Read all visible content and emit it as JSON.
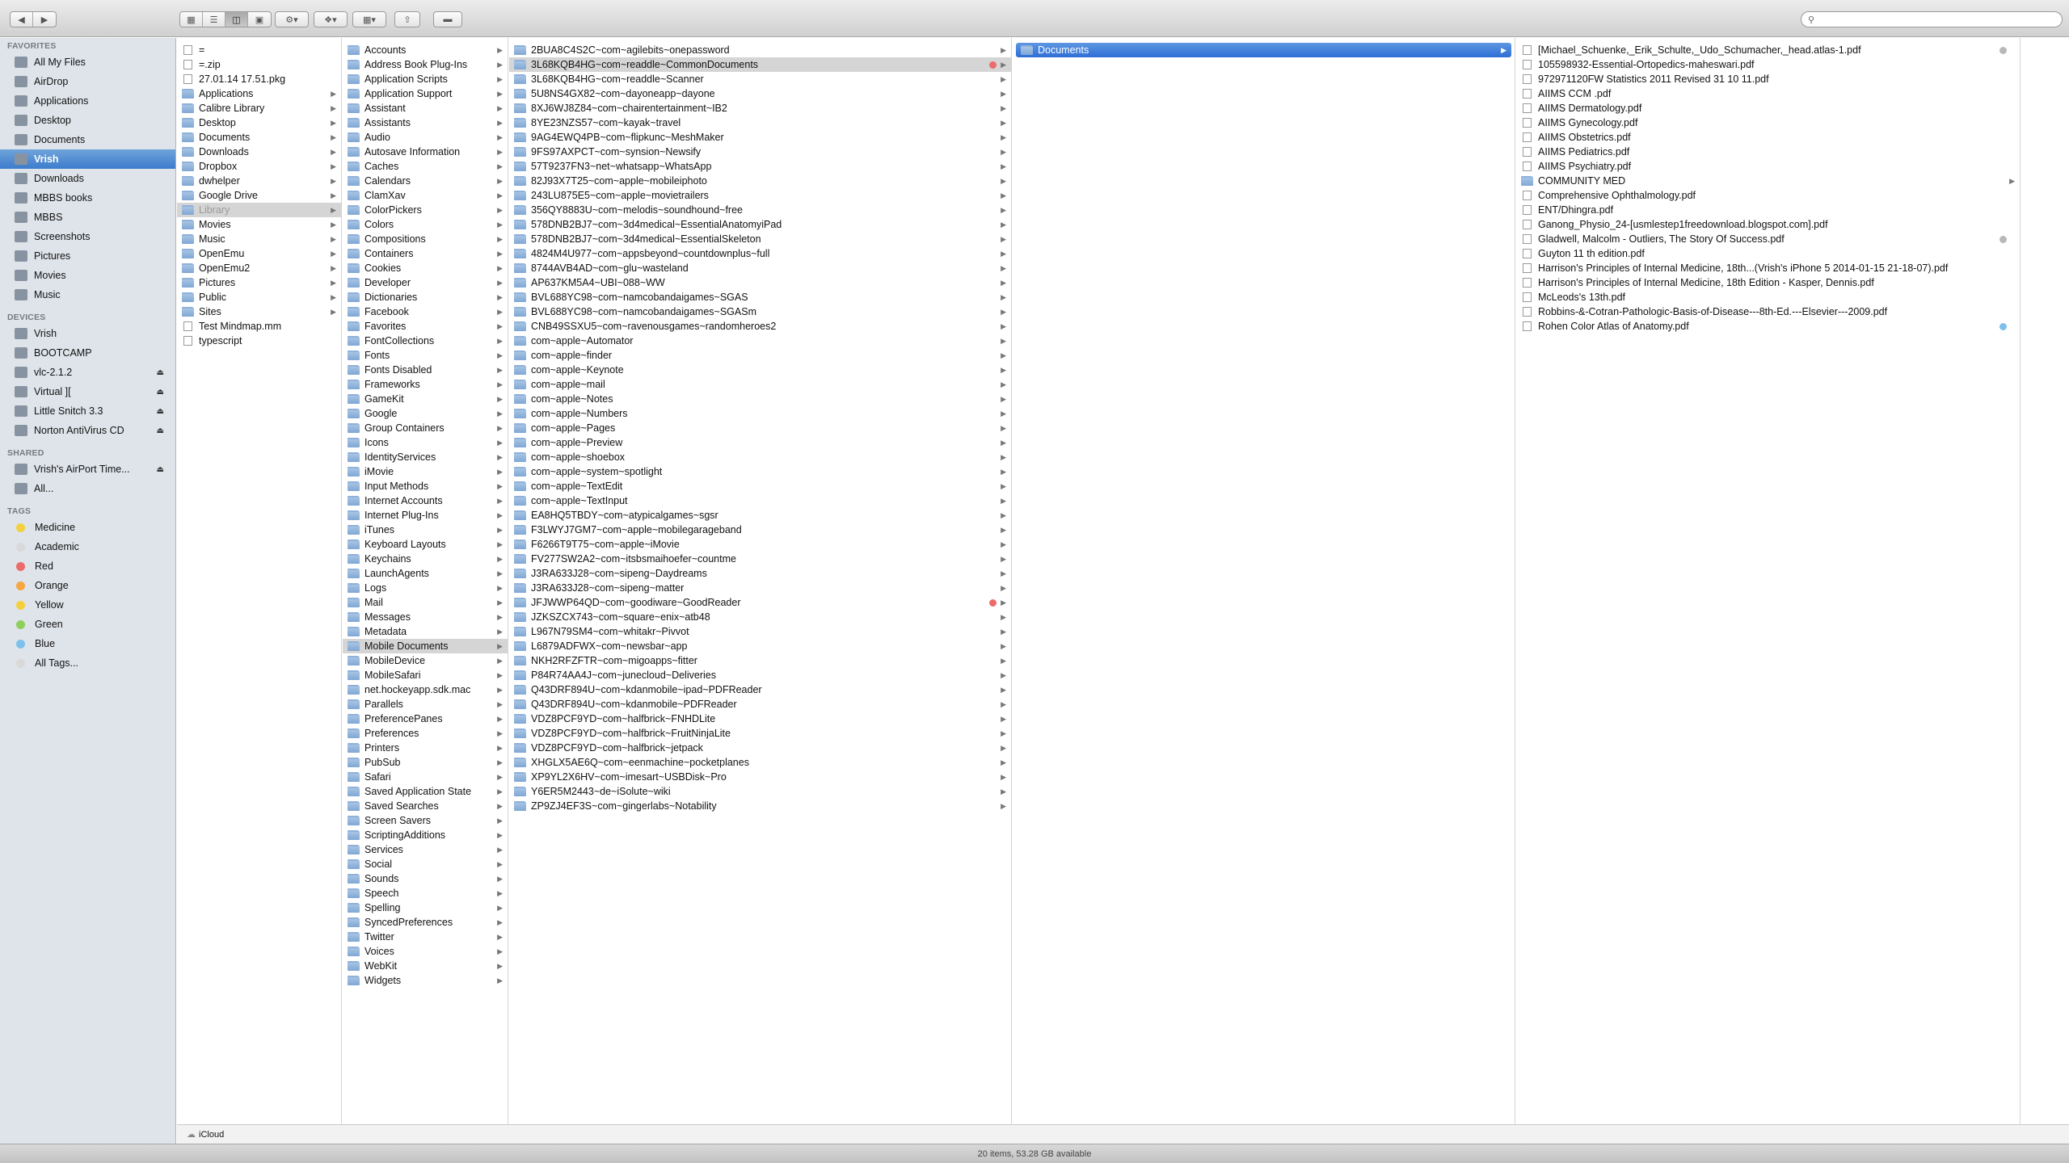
{
  "toolbar": {
    "back_icon": "chevron-left-icon",
    "forward_icon": "chevron-right-icon",
    "view_modes": [
      "icon-view-icon",
      "list-view-icon",
      "column-view-icon",
      "coverflow-view-icon"
    ],
    "action_icon": "gear-icon",
    "dropbox_icon": "dropbox-icon",
    "arrange_icon": "arrange-icon",
    "share_icon": "share-icon",
    "tags_icon": "tag-icon",
    "search_placeholder": ""
  },
  "sidebar": {
    "favorites_header": "FAVORITES",
    "favorites": [
      {
        "label": "All My Files",
        "icon": "all-files-icon"
      },
      {
        "label": "AirDrop",
        "icon": "airdrop-icon"
      },
      {
        "label": "Applications",
        "icon": "applications-icon"
      },
      {
        "label": "Desktop",
        "icon": "desktop-icon"
      },
      {
        "label": "Documents",
        "icon": "documents-icon"
      },
      {
        "label": "Vrish",
        "icon": "home-icon",
        "selected": true
      },
      {
        "label": "Downloads",
        "icon": "downloads-icon"
      },
      {
        "label": "MBBS books",
        "icon": "folder-icon"
      },
      {
        "label": "MBBS",
        "icon": "folder-icon"
      },
      {
        "label": "Screenshots",
        "icon": "folder-icon"
      },
      {
        "label": "Pictures",
        "icon": "pictures-icon"
      },
      {
        "label": "Movies",
        "icon": "movies-icon"
      },
      {
        "label": "Music",
        "icon": "music-icon"
      }
    ],
    "devices_header": "DEVICES",
    "devices": [
      {
        "label": "Vrish",
        "icon": "computer-icon",
        "eject": false
      },
      {
        "label": "BOOTCAMP",
        "icon": "drive-icon",
        "eject": false
      },
      {
        "label": "vlc-2.1.2",
        "icon": "disk-image-icon",
        "eject": true
      },
      {
        "label": "Virtual ][",
        "icon": "disk-image-icon",
        "eject": true
      },
      {
        "label": "Little Snitch 3.3",
        "icon": "disk-image-icon",
        "eject": true
      },
      {
        "label": "Norton AntiVirus CD",
        "icon": "disk-image-icon",
        "eject": true
      }
    ],
    "shared_header": "SHARED",
    "shared": [
      {
        "label": "Vrish's AirPort Time...",
        "icon": "airport-icon",
        "eject": true
      },
      {
        "label": "All...",
        "icon": "network-icon",
        "eject": false
      }
    ],
    "tags_header": "TAGS",
    "tags": [
      {
        "label": "Medicine",
        "color": "#f4d03f"
      },
      {
        "label": "Academic",
        "color": "#d9d9d9"
      },
      {
        "label": "Red",
        "color": "#ec6b6b"
      },
      {
        "label": "Orange",
        "color": "#f5a742"
      },
      {
        "label": "Yellow",
        "color": "#f4d03f"
      },
      {
        "label": "Green",
        "color": "#8fcf5a"
      },
      {
        "label": "Blue",
        "color": "#7ec0ec"
      },
      {
        "label": "All Tags...",
        "color": "#d9d9d9"
      }
    ]
  },
  "columns": [
    {
      "items": [
        {
          "label": "=",
          "type": "file"
        },
        {
          "label": "=.zip",
          "type": "file"
        },
        {
          "label": "27.01.14 17.51.pkg",
          "type": "file"
        },
        {
          "label": "Applications",
          "type": "folder",
          "arrow": true
        },
        {
          "label": "Calibre Library",
          "type": "folder",
          "arrow": true
        },
        {
          "label": "Desktop",
          "type": "folder",
          "arrow": true
        },
        {
          "label": "Documents",
          "type": "folder",
          "arrow": true
        },
        {
          "label": "Downloads",
          "type": "folder",
          "arrow": true
        },
        {
          "label": "Dropbox",
          "type": "folder",
          "arrow": true
        },
        {
          "label": "dwhelper",
          "type": "folder",
          "arrow": true
        },
        {
          "label": "Google Drive",
          "type": "folder",
          "arrow": true
        },
        {
          "label": "Library",
          "type": "folder",
          "arrow": true,
          "state": "selected-dim"
        },
        {
          "label": "Movies",
          "type": "folder",
          "arrow": true
        },
        {
          "label": "Music",
          "type": "folder",
          "arrow": true
        },
        {
          "label": "OpenEmu",
          "type": "folder",
          "arrow": true
        },
        {
          "label": "OpenEmu2",
          "type": "folder",
          "arrow": true
        },
        {
          "label": "Pictures",
          "type": "folder",
          "arrow": true
        },
        {
          "label": "Public",
          "type": "folder",
          "arrow": true
        },
        {
          "label": "Sites",
          "type": "folder",
          "arrow": true
        },
        {
          "label": "Test Mindmap.mm",
          "type": "file"
        },
        {
          "label": "typescript",
          "type": "file"
        }
      ]
    },
    {
      "items": [
        {
          "label": "Accounts"
        },
        {
          "label": "Address Book Plug-Ins"
        },
        {
          "label": "Application Scripts"
        },
        {
          "label": "Application Support"
        },
        {
          "label": "Assistant"
        },
        {
          "label": "Assistants"
        },
        {
          "label": "Audio"
        },
        {
          "label": "Autosave Information"
        },
        {
          "label": "Caches"
        },
        {
          "label": "Calendars"
        },
        {
          "label": "ClamXav"
        },
        {
          "label": "ColorPickers"
        },
        {
          "label": "Colors"
        },
        {
          "label": "Compositions"
        },
        {
          "label": "Containers"
        },
        {
          "label": "Cookies"
        },
        {
          "label": "Developer"
        },
        {
          "label": "Dictionaries"
        },
        {
          "label": "Facebook"
        },
        {
          "label": "Favorites"
        },
        {
          "label": "FontCollections"
        },
        {
          "label": "Fonts"
        },
        {
          "label": "Fonts Disabled"
        },
        {
          "label": "Frameworks"
        },
        {
          "label": "GameKit"
        },
        {
          "label": "Google"
        },
        {
          "label": "Group Containers"
        },
        {
          "label": "Icons"
        },
        {
          "label": "IdentityServices"
        },
        {
          "label": "iMovie"
        },
        {
          "label": "Input Methods"
        },
        {
          "label": "Internet Accounts"
        },
        {
          "label": "Internet Plug-Ins"
        },
        {
          "label": "iTunes"
        },
        {
          "label": "Keyboard Layouts"
        },
        {
          "label": "Keychains"
        },
        {
          "label": "LaunchAgents"
        },
        {
          "label": "Logs"
        },
        {
          "label": "Mail"
        },
        {
          "label": "Messages"
        },
        {
          "label": "Metadata"
        },
        {
          "label": "Mobile Documents",
          "state": "selected-gray"
        },
        {
          "label": "MobileDevice"
        },
        {
          "label": "MobileSafari"
        },
        {
          "label": "net.hockeyapp.sdk.mac"
        },
        {
          "label": "Parallels"
        },
        {
          "label": "PreferencePanes"
        },
        {
          "label": "Preferences"
        },
        {
          "label": "Printers"
        },
        {
          "label": "PubSub"
        },
        {
          "label": "Safari"
        },
        {
          "label": "Saved Application State"
        },
        {
          "label": "Saved Searches"
        },
        {
          "label": "Screen Savers"
        },
        {
          "label": "ScriptingAdditions"
        },
        {
          "label": "Services"
        },
        {
          "label": "Social"
        },
        {
          "label": "Sounds"
        },
        {
          "label": "Speech"
        },
        {
          "label": "Spelling"
        },
        {
          "label": "SyncedPreferences"
        },
        {
          "label": "Twitter"
        },
        {
          "label": "Voices"
        },
        {
          "label": "WebKit"
        },
        {
          "label": "Widgets"
        }
      ]
    },
    {
      "items": [
        {
          "label": "2BUA8C4S2C~com~agilebits~onepassword"
        },
        {
          "label": "3L68KQB4HG~com~readdle~CommonDocuments",
          "state": "selected-gray",
          "tag": "red"
        },
        {
          "label": "3L68KQB4HG~com~readdle~Scanner"
        },
        {
          "label": "5U8NS4GX82~com~dayoneapp~dayone"
        },
        {
          "label": "8XJ6WJ8Z84~com~chairentertainment~IB2"
        },
        {
          "label": "8YE23NZS57~com~kayak~travel"
        },
        {
          "label": "9AG4EWQ4PB~com~flipkunc~MeshMaker"
        },
        {
          "label": "9FS97AXPCT~com~synsion~Newsify"
        },
        {
          "label": "57T9237FN3~net~whatsapp~WhatsApp"
        },
        {
          "label": "82J93X7T25~com~apple~mobileiphoto"
        },
        {
          "label": "243LU875E5~com~apple~movietrailers"
        },
        {
          "label": "356QY8883U~com~melodis~soundhound~free"
        },
        {
          "label": "578DNB2BJ7~com~3d4medical~EssentialAnatomyiPad"
        },
        {
          "label": "578DNB2BJ7~com~3d4medical~EssentialSkeleton"
        },
        {
          "label": "4824M4U977~com~appsbeyond~countdownplus~full"
        },
        {
          "label": "8744AVB4AD~com~glu~wasteland"
        },
        {
          "label": "AP637KM5A4~UBI~088~WW"
        },
        {
          "label": "BVL688YC98~com~namcobandaigames~SGAS"
        },
        {
          "label": "BVL688YC98~com~namcobandaigames~SGASm"
        },
        {
          "label": "CNB49SSXU5~com~ravenousgames~randomheroes2"
        },
        {
          "label": "com~apple~Automator"
        },
        {
          "label": "com~apple~finder"
        },
        {
          "label": "com~apple~Keynote"
        },
        {
          "label": "com~apple~mail"
        },
        {
          "label": "com~apple~Notes"
        },
        {
          "label": "com~apple~Numbers"
        },
        {
          "label": "com~apple~Pages"
        },
        {
          "label": "com~apple~Preview"
        },
        {
          "label": "com~apple~shoebox"
        },
        {
          "label": "com~apple~system~spotlight"
        },
        {
          "label": "com~apple~TextEdit"
        },
        {
          "label": "com~apple~TextInput"
        },
        {
          "label": "EA8HQ5TBDY~com~atypicalgames~sgsr"
        },
        {
          "label": "F3LWYJ7GM7~com~apple~mobilegarageband"
        },
        {
          "label": "F6266T9T75~com~apple~iMovie"
        },
        {
          "label": "FV277SW2A2~com~itsbsmaihoefer~countme"
        },
        {
          "label": "J3RA633J28~com~sipeng~Daydreams"
        },
        {
          "label": "J3RA633J28~com~sipeng~matter"
        },
        {
          "label": "JFJWWP64QD~com~goodiware~GoodReader",
          "tag": "red"
        },
        {
          "label": "JZKSZCX743~com~square~enix~atb48"
        },
        {
          "label": "L967N79SM4~com~whitakr~Pivvot"
        },
        {
          "label": "L6879ADFWX~com~newsbar~app"
        },
        {
          "label": "NKH2RFZFTR~com~migoapps~fitter"
        },
        {
          "label": "P84R74AA4J~com~junecloud~Deliveries"
        },
        {
          "label": "Q43DRF894U~com~kdanmobile~ipad~PDFReader"
        },
        {
          "label": "Q43DRF894U~com~kdanmobile~PDFReader"
        },
        {
          "label": "VDZ8PCF9YD~com~halfbrick~FNHDLite"
        },
        {
          "label": "VDZ8PCF9YD~com~halfbrick~FruitNinjaLite"
        },
        {
          "label": "VDZ8PCF9YD~com~halfbrick~jetpack"
        },
        {
          "label": "XHGLX5AE6Q~com~eenmachine~pocketplanes"
        },
        {
          "label": "XP9YL2X6HV~com~imesart~USBDisk~Pro"
        },
        {
          "label": "Y6ER5M2443~de~iSolute~wiki"
        },
        {
          "label": "ZP9ZJ4EF3S~com~gingerlabs~Notability"
        }
      ]
    },
    {
      "items": [
        {
          "label": "Documents",
          "state": "selected-blue"
        }
      ]
    },
    {
      "items": [
        {
          "label": "[Michael_Schuenke,_Erik_Schulte,_Udo_Schumacher,_head.atlas-1.pdf",
          "type": "file",
          "tag": "gray"
        },
        {
          "label": "105598932-Essential-Ortopedics-maheswari.pdf",
          "type": "file"
        },
        {
          "label": "972971120FW Statistics 2011 Revised 31 10 11.pdf",
          "type": "file"
        },
        {
          "label": "AIIMS CCM .pdf",
          "type": "file"
        },
        {
          "label": "AIIMS Dermatology.pdf",
          "type": "file"
        },
        {
          "label": "AIIMS Gynecology.pdf",
          "type": "file"
        },
        {
          "label": "AIIMS Obstetrics.pdf",
          "type": "file"
        },
        {
          "label": "AIIMS Pediatrics.pdf",
          "type": "file"
        },
        {
          "label": "AIIMS Psychiatry.pdf",
          "type": "file"
        },
        {
          "label": "COMMUNITY MED",
          "type": "folder",
          "arrow": true
        },
        {
          "label": "Comprehensive Ophthalmology.pdf",
          "type": "file"
        },
        {
          "label": "ENT/Dhingra.pdf",
          "type": "file"
        },
        {
          "label": "Ganong_Physio_24-[usmlestep1freedownload.blogspot.com].pdf",
          "type": "file"
        },
        {
          "label": "Gladwell, Malcolm - Outliers, The Story Of Success.pdf",
          "type": "file",
          "tag": "gray"
        },
        {
          "label": "Guyton 11 th edition.pdf",
          "type": "file"
        },
        {
          "label": "Harrison's Principles of Internal Medicine, 18th...(Vrish's iPhone 5 2014-01-15 21-18-07).pdf",
          "type": "file"
        },
        {
          "label": "Harrison's Principles of Internal Medicine, 18th Edition - Kasper, Dennis.pdf",
          "type": "file"
        },
        {
          "label": "McLeods's 13th.pdf",
          "type": "file"
        },
        {
          "label": "Robbins-&-Cotran-Pathologic-Basis-of-Disease---8th-Ed.---Elsevier---2009.pdf",
          "type": "file"
        },
        {
          "label": "Rohen Color Atlas of  Anatomy.pdf",
          "type": "file",
          "tag": "blue"
        }
      ]
    }
  ],
  "pathbar": {
    "icon": "icloud-icon",
    "label": "iCloud"
  },
  "status": {
    "text": "20 items, 53.28 GB available"
  }
}
